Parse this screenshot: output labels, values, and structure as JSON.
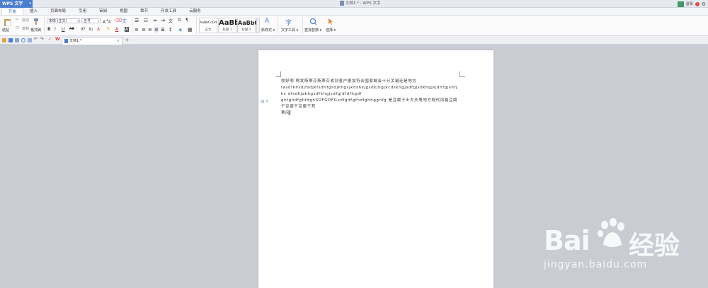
{
  "app": {
    "name": "WPS 文字",
    "window_title": "文档1 * - WPS 文字",
    "login_label": "登录"
  },
  "menu": {
    "tabs": [
      "开始",
      "插入",
      "页面布局",
      "引用",
      "审阅",
      "视图",
      "章节",
      "开发工具",
      "云服务"
    ],
    "active": "开始"
  },
  "ribbon": {
    "paste": "粘贴",
    "cut": "剪切",
    "copy": "复制",
    "format_painter": "格式刷",
    "font_name": "宋体 (正文)",
    "font_size": "五号",
    "styles": [
      {
        "sample": "AaBbCcDd",
        "name": "正文"
      },
      {
        "sample": "AaBb",
        "name": "标题 1"
      },
      {
        "sample": "AaBbC",
        "name": "标题 2"
      }
    ],
    "new_style": "新样式",
    "text_tools": "文字工具",
    "find_replace": "查找替换",
    "select": "选择"
  },
  "doc_tab": {
    "label": "文档1 *"
  },
  "document": {
    "lines": [
      "你好啊  啊发斯蒂芬斯蒂芬收到客户更加符合国家邮会十分关键还是地方",
      "fasdfkhsdjfsdjkfsdhfgsdjkhgsjkdshkjgsdkjhgjkcdskhgjsdfgjsdkhgjsjdhfgjshfjks dfsdkjakhgsdfkhgjsdfgjdfdfhgdf",
      "ghfghdfghfdghSDFGDFGxdfgdfgfhdfghhgghfg 是豆腐干士大夫鬼地方规代风格豆腐干豆腐干豆腐干梵",
      "蒂冈"
    ]
  },
  "watermark": {
    "brand": "Bai",
    "brand_cn": "经验",
    "url": "jingyan.baidu.com"
  },
  "colors": {
    "accent": "#4a7ed1",
    "workspace": "#c9ccd3"
  }
}
